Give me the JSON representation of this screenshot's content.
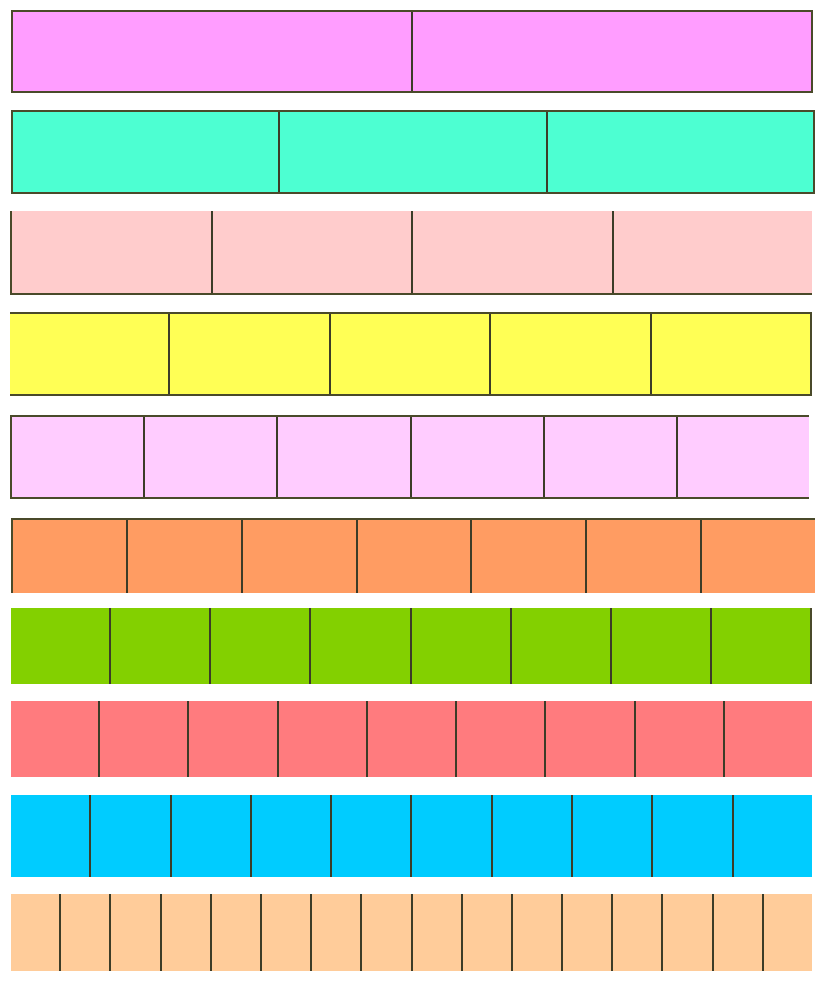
{
  "fraction_strips": [
    {
      "parts": 2,
      "color": "#ff9dff"
    },
    {
      "parts": 3,
      "color": "#4dffd2"
    },
    {
      "parts": 4,
      "color": "#ffcccc"
    },
    {
      "parts": 5,
      "color": "#ffff55"
    },
    {
      "parts": 6,
      "color": "#ffccff"
    },
    {
      "parts": 7,
      "color": "#ff9c62"
    },
    {
      "parts": 8,
      "color": "#83d000"
    },
    {
      "parts": 9,
      "color": "#ff7b7e"
    },
    {
      "parts": 10,
      "color": "#00ccff"
    },
    {
      "parts": 16,
      "color": "#ffcc9a"
    }
  ]
}
